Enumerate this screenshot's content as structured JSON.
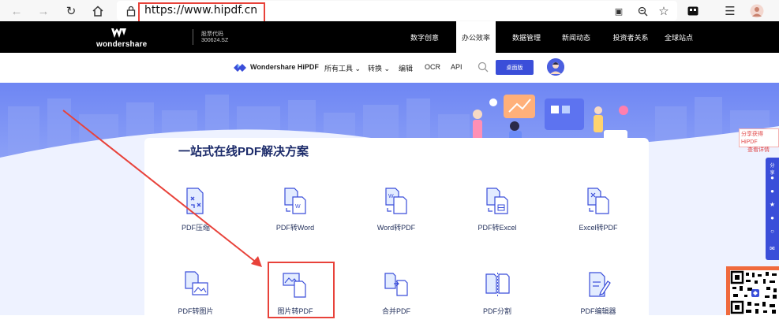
{
  "browser": {
    "url": "https://www.hipdf.cn",
    "back_icon": "back-arrow-icon",
    "forward_icon": "forward-arrow-icon",
    "reload_icon": "reload-icon",
    "home_icon": "home-icon"
  },
  "topbar": {
    "logo_text": "wondershare",
    "stock_label": "股票代码",
    "stock_code": "300624.SZ",
    "nav": [
      "数字创意",
      "办公效率",
      "数据管理",
      "新闻动态",
      "投资者关系",
      "全球站点"
    ],
    "active_nav": "办公效率"
  },
  "product_nav": {
    "brand": "Wondershare HiPDF",
    "items": [
      "所有工具",
      "转换",
      "编辑",
      "OCR",
      "API"
    ],
    "cta": "桌面版"
  },
  "hero": {
    "title": "一站式在线PDF解决方案"
  },
  "tools": {
    "row1": [
      "PDF压缩",
      "PDF转Word",
      "Word转PDF",
      "PDF转Excel",
      "Excel转PDF"
    ],
    "row2": [
      "PDF转图片",
      "图片转PDF",
      "合并PDF",
      "PDF分割",
      "PDF编辑器"
    ]
  },
  "side": {
    "share_line1": "分享获得HiPDF",
    "share_line2": "查看详情",
    "share_tab": "分享"
  },
  "colors": {
    "accent": "#3a4ed9",
    "annotation": "#e8423a",
    "hero_top": "#6e86f3"
  }
}
